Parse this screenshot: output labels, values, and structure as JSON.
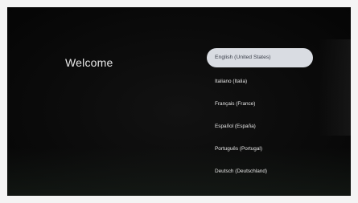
{
  "welcome": {
    "title": "Welcome"
  },
  "languages": [
    {
      "label": "English (United States)",
      "selected": true
    },
    {
      "label": "Italiano (Italia)",
      "selected": false
    },
    {
      "label": "Français (France)",
      "selected": false
    },
    {
      "label": "Español (España)",
      "selected": false
    },
    {
      "label": "Português (Portugal)",
      "selected": false
    },
    {
      "label": "Deutsch (Deutschland)",
      "selected": false
    }
  ],
  "colors": {
    "screen_background": "#0a0a0a",
    "selected_pill": "#d9dce2",
    "text": "#e6e6e6"
  }
}
